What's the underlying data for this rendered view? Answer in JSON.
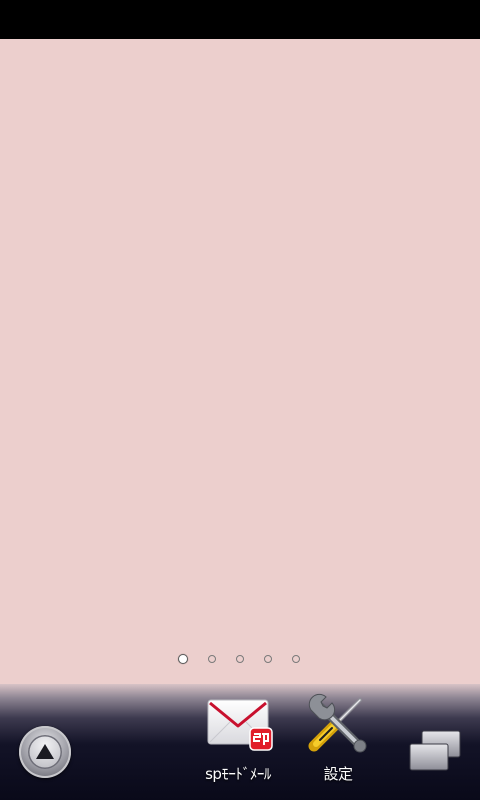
{
  "status_bar": {
    "color": "#000000"
  },
  "wallpaper": {
    "color": "#eccfcd"
  },
  "page_indicator": {
    "page_count": 5,
    "current_page": 1
  },
  "dock": {
    "drawer_button": {
      "icon": "app-drawer-up-arrow-icon"
    },
    "apps": [
      {
        "label": "spﾓｰﾄﾞﾒｰﾙ",
        "icon": "sp-mode-mail-envelope-icon"
      },
      {
        "label": "設定",
        "icon": "settings-wrench-screwdriver-icon"
      }
    ],
    "recents_button": {
      "icon": "recent-windows-icon"
    }
  }
}
